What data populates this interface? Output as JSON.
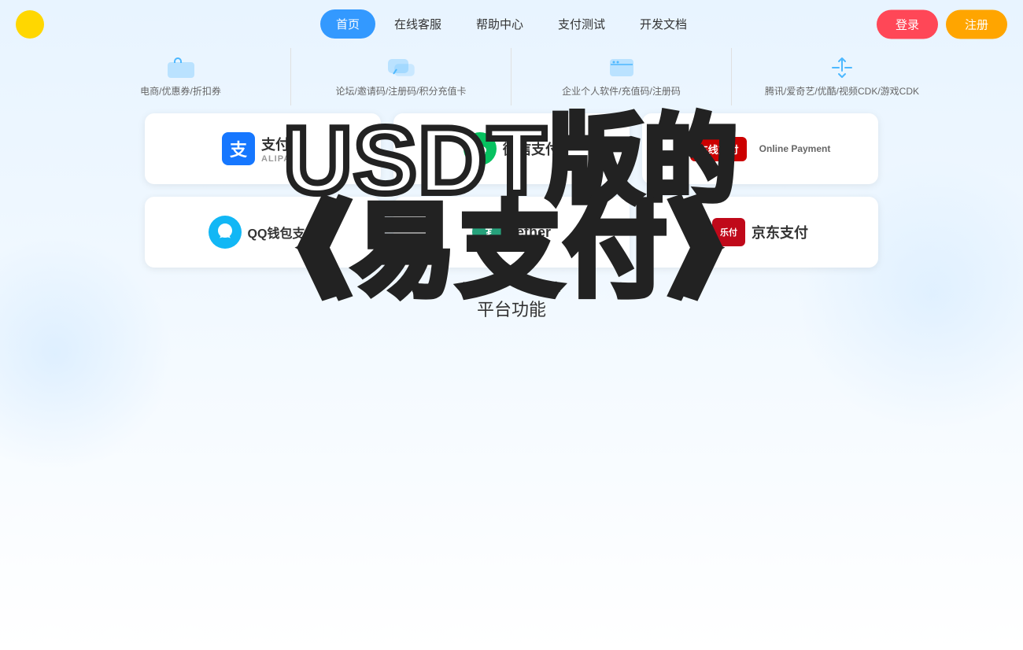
{
  "nav": {
    "items": [
      {
        "label": "首页",
        "active": true
      },
      {
        "label": "在线客服",
        "active": false
      },
      {
        "label": "帮助中心",
        "active": false
      },
      {
        "label": "支付测试",
        "active": false
      },
      {
        "label": "开发文档",
        "active": false
      }
    ],
    "login_label": "登录",
    "register_label": "注册"
  },
  "categories": [
    {
      "label": "电商/优惠券/折扣券"
    },
    {
      "label": "论坛/邀请码/注册码/积分充值卡"
    },
    {
      "label": "企业个人软件/充值码/注册码"
    },
    {
      "label": "腾讯/爱奇艺/优酷/视频CDK/游戏CDK"
    }
  ],
  "hero": {
    "line1": "USDT版的",
    "line2": "《易支付》"
  },
  "payment_methods": {
    "row1": [
      {
        "id": "alipay",
        "name": "支付宝",
        "sub": "ALIPAY"
      },
      {
        "id": "wechat",
        "name": "微信支付"
      },
      {
        "id": "online",
        "name": "在线支付",
        "sub": "Online Payment"
      }
    ],
    "row2": [
      {
        "id": "qq",
        "name": "QQ钱包支付"
      },
      {
        "id": "tether",
        "name": "tether"
      },
      {
        "id": "jd",
        "name": "京东支付"
      }
    ]
  },
  "bottom": {
    "platform_label": "平台功能"
  }
}
